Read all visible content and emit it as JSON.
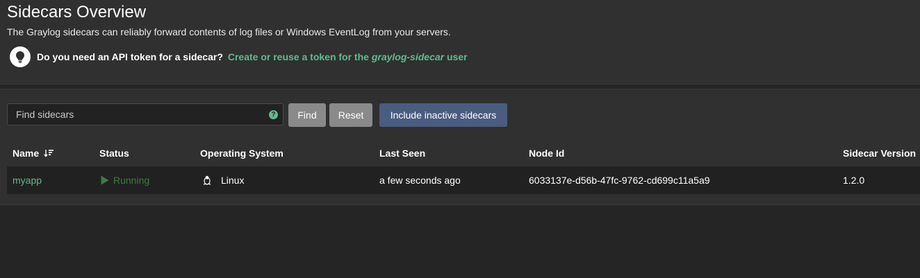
{
  "header": {
    "title": "Sidecars Overview",
    "description": "The Graylog sidecars can reliably forward contents of log files or Windows EventLog from your servers.",
    "hint_question": "Do you need an API token for a sidecar?",
    "hint_link_prefix": "Create or reuse a token for the ",
    "hint_link_user": "graylog-sidecar",
    "hint_link_suffix": " user",
    "hint_icon": "lightbulb-icon"
  },
  "toolbar": {
    "search_placeholder": "Find sidecars",
    "search_value": "",
    "find_label": "Find",
    "reset_label": "Reset",
    "inactive_label": "Include inactive sidecars"
  },
  "table": {
    "columns": [
      "Name",
      "Status",
      "Operating System",
      "Last Seen",
      "Node Id",
      "Sidecar Version"
    ],
    "rows": [
      {
        "name": "myapp",
        "status": "Running",
        "os": "Linux",
        "last_seen": "a few seconds ago",
        "node_id": "6033137e-d56b-47fc-9762-cd699c11a5a9",
        "version": "1.2.0"
      }
    ]
  },
  "colors": {
    "background": "#252525",
    "panel": "#303030",
    "accent_green": "#63b98f",
    "status_running": "#3c7d3c",
    "button_gray": "#8a8a8a",
    "button_primary": "#4a5c7f"
  }
}
